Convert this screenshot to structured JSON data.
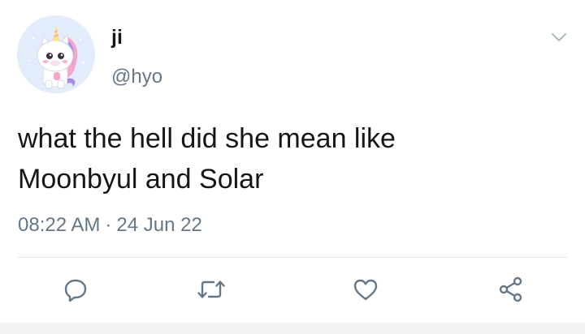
{
  "user": {
    "display_name": "ji",
    "handle": "@hyo",
    "avatar_icon": "unicorn-avatar-icon"
  },
  "tweet": {
    "text_lines": [
      "what the hell did she mean like",
      "Moonbyul and Solar"
    ],
    "time": "08:22 AM",
    "separator": "·",
    "date": "24 Jun 22"
  },
  "actions": [
    {
      "icon": "reply-icon"
    },
    {
      "icon": "retweet-icon"
    },
    {
      "icon": "like-icon"
    },
    {
      "icon": "share-icon"
    }
  ],
  "colors": {
    "text": "#14171a",
    "secondary": "#657786",
    "icon": "#657786",
    "divider": "#e1e8ed"
  }
}
